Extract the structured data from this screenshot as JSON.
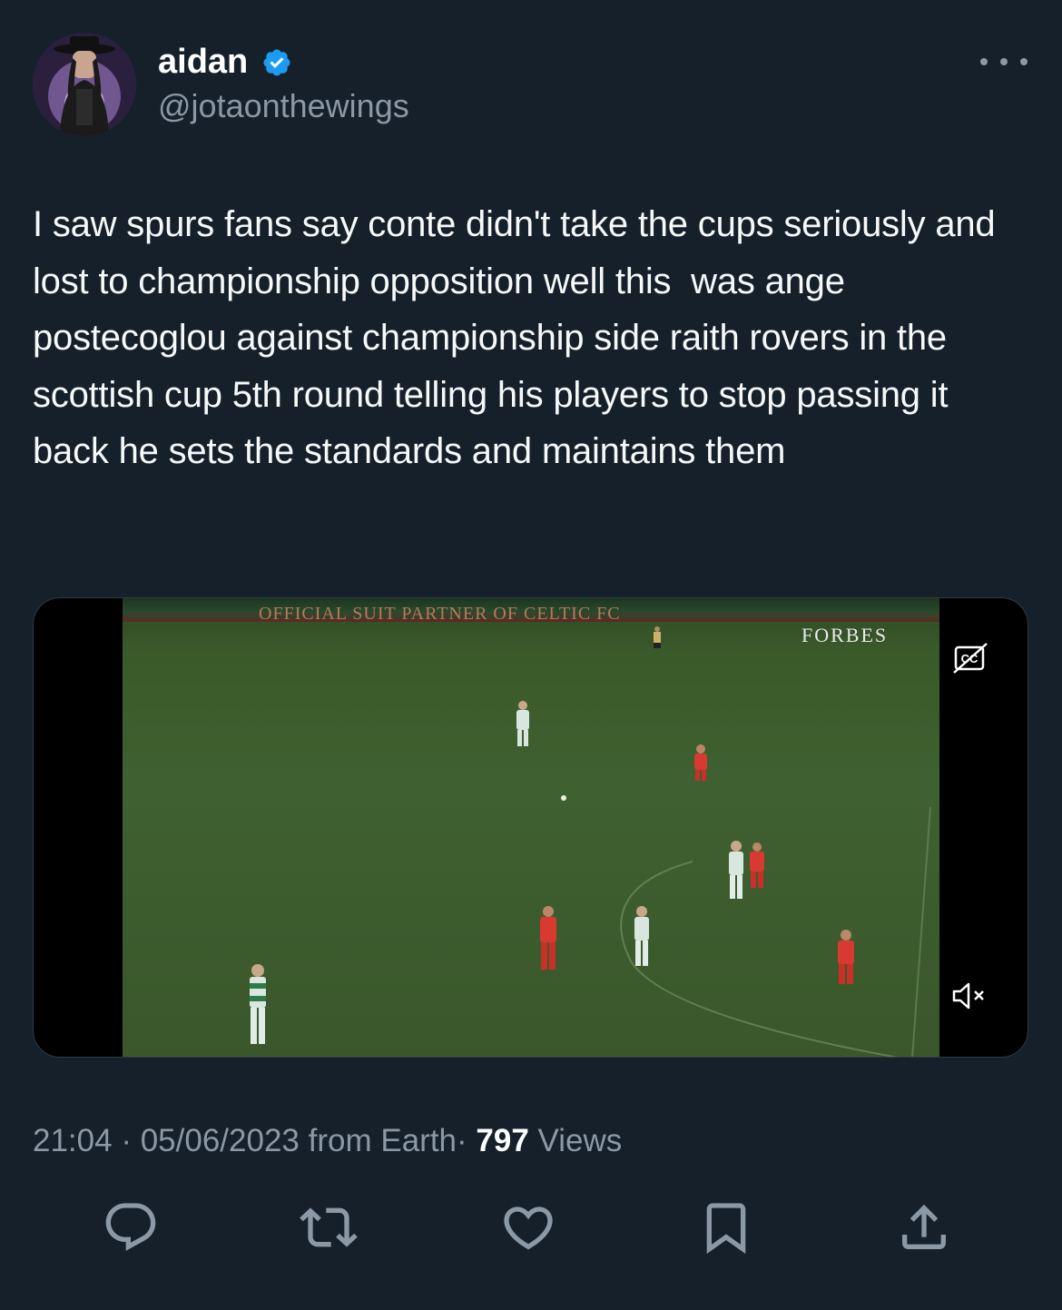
{
  "author": {
    "display_name": "aidan",
    "handle": "@jotaonthewings",
    "verified": true,
    "verified_color": "#1d9bf0"
  },
  "tweet": {
    "text": "I saw spurs fans say conte didn't take the cups seriously and lost to championship opposition well this  was ange postecoglou against championship side raith rovers in the scottish cup 5th round telling his players to stop passing it back he sets the standards and maintains them"
  },
  "video": {
    "ad_board_text": "OFFICIAL SUIT PARTNER OF CELTIC FC",
    "sponsor_text": "FORBES",
    "captions_icon": "captions-off-icon",
    "volume_icon": "volume-muted-icon"
  },
  "meta": {
    "time": "21:04",
    "separator": "·",
    "date": "05/06/2023",
    "source": "from Earth",
    "views_count": "797",
    "views_label": "Views"
  },
  "actions": [
    {
      "name": "reply",
      "icon": "reply-icon"
    },
    {
      "name": "retweet",
      "icon": "retweet-icon"
    },
    {
      "name": "like",
      "icon": "heart-icon"
    },
    {
      "name": "bookmark",
      "icon": "bookmark-icon"
    },
    {
      "name": "share",
      "icon": "share-icon"
    }
  ],
  "colors": {
    "background": "#15202b",
    "secondary_text": "#8b98a5",
    "primary_text": "#f7f9f9"
  }
}
